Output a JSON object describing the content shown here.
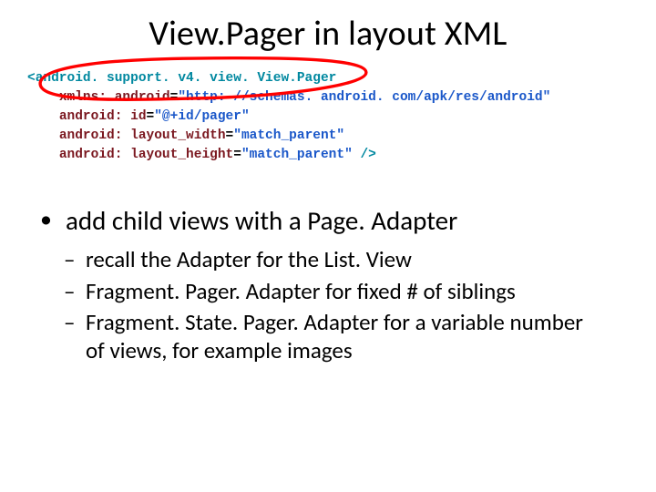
{
  "title": "View.Pager in layout XML",
  "code": {
    "line1_tag_open": "<android. support. v4. view. View.Pager",
    "line2_attr": "xmlns: android",
    "line2_val": "\"http: //schemas. android. com/apk/res/android\"",
    "line3_attr": "android: id",
    "line3_val": "\"@+id/pager\"",
    "line4_attr": "android: layout_width",
    "line4_val": "\"match_parent\"",
    "line5_attr": "android: layout_height",
    "line5_val": "\"match_parent\"",
    "line5_close": " />",
    "eq": "="
  },
  "bullets": {
    "l1_1": "add child views with a Page. Adapter",
    "l2_1": "recall the Adapter for the List. View",
    "l2_2": "Fragment. Pager. Adapter for fixed # of siblings",
    "l2_3": "Fragment. State. Pager. Adapter for a variable number of views, for example images"
  },
  "colors": {
    "markup_red": "#ff0000"
  }
}
